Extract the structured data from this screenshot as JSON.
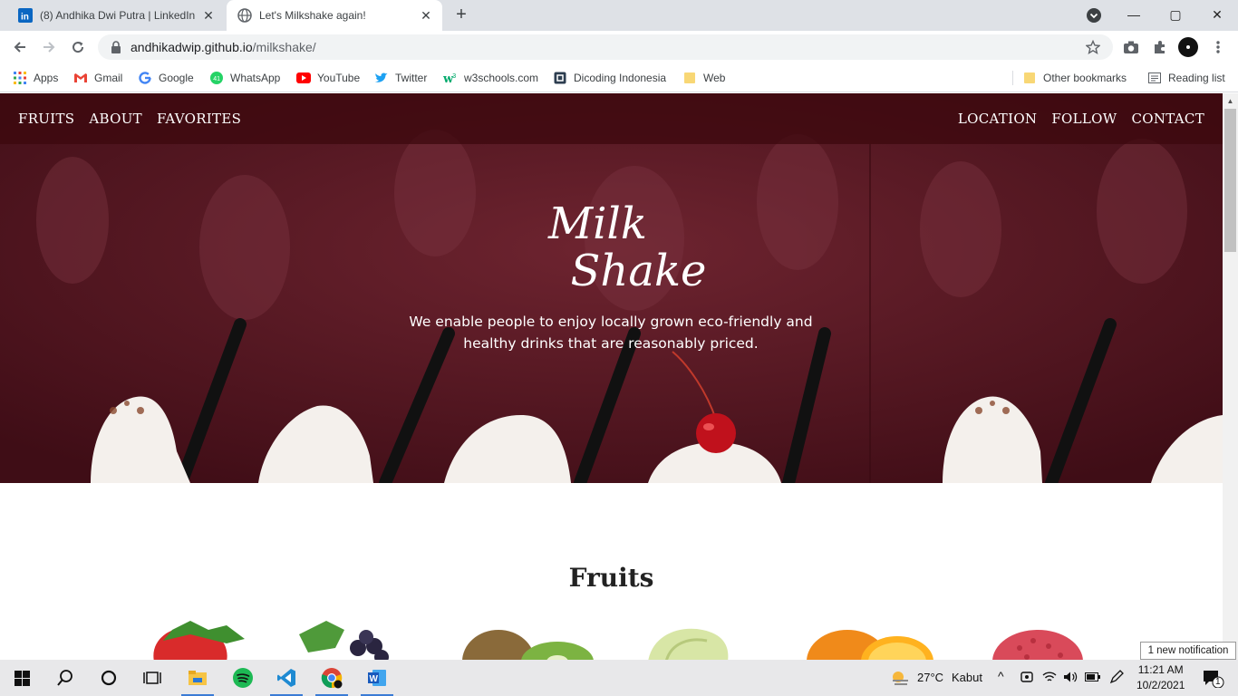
{
  "browser": {
    "tabs": [
      {
        "title": "(8) Andhika Dwi Putra | LinkedIn",
        "active": false
      },
      {
        "title": "Let's Milkshake again!",
        "active": true
      }
    ],
    "new_tab_symbol": "+",
    "close_symbol": "✕",
    "window_controls": {
      "minimize": "—",
      "maximize": "▢",
      "close": "✕"
    },
    "url_host": "andhikadwip.github.io",
    "url_path": "/milkshake/",
    "bookmarks": [
      {
        "label": "Apps",
        "icon": "apps-grid-icon"
      },
      {
        "label": "Gmail",
        "icon": "gmail-icon"
      },
      {
        "label": "Google",
        "icon": "google-icon"
      },
      {
        "label": "WhatsApp",
        "icon": "whatsapp-icon"
      },
      {
        "label": "YouTube",
        "icon": "youtube-icon"
      },
      {
        "label": "Twitter",
        "icon": "twitter-icon"
      },
      {
        "label": "w3schools.com",
        "icon": "w3schools-icon"
      },
      {
        "label": "Dicoding Indonesia",
        "icon": "dicoding-icon"
      },
      {
        "label": "Web",
        "icon": "folder-icon"
      }
    ],
    "other_bookmarks": "Other bookmarks",
    "reading_list": "Reading list"
  },
  "site": {
    "nav_left": [
      "FRUITS",
      "ABOUT",
      "FAVORITES"
    ],
    "nav_right": [
      "LOCATION",
      "FOLLOW",
      "CONTACT"
    ],
    "brand_line1": "Milk",
    "brand_line2": "Shake",
    "tagline": "We enable people to enjoy locally grown eco-friendly and healthy drinks that are reasonably priced.",
    "section_title": "Fruits",
    "fruits": [
      "strawberry-image",
      "grapes-image",
      "kiwi-image",
      "melon-image",
      "orange-image",
      "lychee-image"
    ],
    "colors": {
      "hero": "#5a1a24",
      "nav": "#3c080e"
    }
  },
  "taskbar": {
    "weather_temp": "27°C",
    "weather_desc": "Kabut",
    "time": "11:21 AM",
    "date": "10/2/2021",
    "notification": "1 new notification",
    "notification_count": "1"
  }
}
